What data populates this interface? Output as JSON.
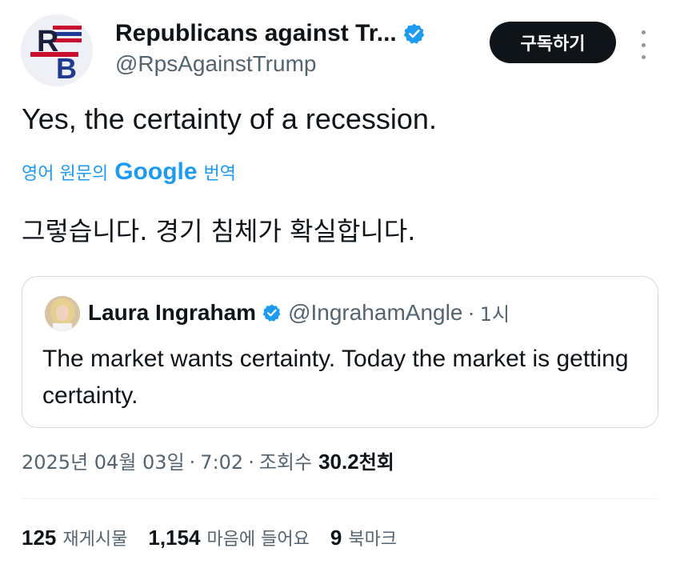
{
  "author": {
    "avatar_letters": "RB",
    "display_name": "Republicans against Tr...",
    "handle": "@RpsAgainstTrump",
    "verified_icon": "verified-badge-icon"
  },
  "header": {
    "subscribe_label": "구독하기",
    "more_icon": "more-vertical-icon"
  },
  "tweet": {
    "text": "Yes, the certainty of a recession.",
    "translate": {
      "prefix": "영어 원문의",
      "brand": "Google",
      "suffix": "번역"
    },
    "translated_text": "그렇습니다. 경기 침체가 확실합니다."
  },
  "quote": {
    "name": "Laura Ingraham",
    "handle": "@IngrahamAngle",
    "separator": "·",
    "time": "1시",
    "text": "The market wants certainty.  Today the market is getting certainty."
  },
  "meta": {
    "date": "2025년 04월 03일",
    "sep1": "·",
    "time": "7:02",
    "sep2": "·",
    "views_label": "조회수",
    "views_value": "30.2",
    "views_unit": "천회"
  },
  "stats": [
    {
      "value": "125",
      "label": "재게시물"
    },
    {
      "value": "1,154",
      "label": "마음에 들어요"
    },
    {
      "value": "9",
      "label": "북마크"
    }
  ],
  "colors": {
    "accent": "#1d9bf0",
    "text_primary": "#0f1419",
    "text_secondary": "#536471",
    "border": "#cfd9de",
    "button_bg": "#0f1419"
  }
}
